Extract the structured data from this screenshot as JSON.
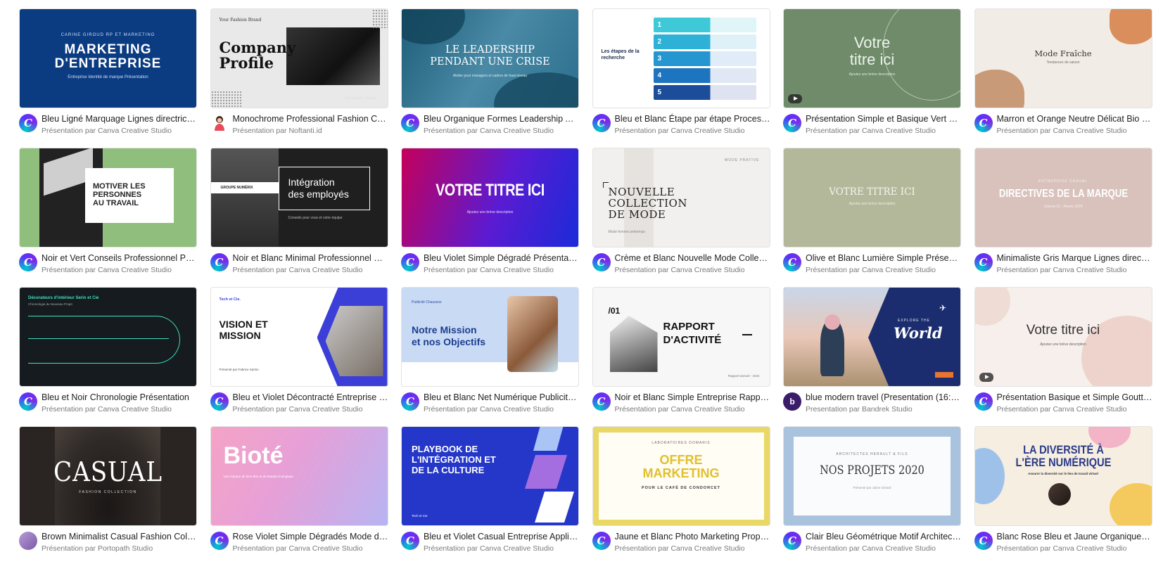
{
  "cards": [
    {
      "title": "Bleu Ligné Marquage Lignes directrices ...",
      "author": "Présentation par Canva Creative Studio",
      "avatar": "canva",
      "thumb": {
        "kicker": "CARINE GIROUD RP ET MARKETING",
        "heading": "MARKETING\nD'ENTREPRISE",
        "sub": "Entreprise Identité de marque Présentation"
      }
    },
    {
      "title": "Monochrome Professional Fashion Com...",
      "author": "Présentation par Noftanti.id",
      "avatar": "nofanti",
      "thumb": {
        "kicker": "Your Fashion Brand",
        "heading": "Company\nProfile",
        "sub": "Your Brand's Tagline"
      }
    },
    {
      "title": "Bleu Organique Formes Leadership Ateli...",
      "author": "Présentation par Canva Creative Studio",
      "avatar": "canva",
      "thumb": {
        "heading": "LE LEADERSHIP\nPENDANT UNE CRISE",
        "sub": "Atelier pour managers et cadres de haut niveau"
      }
    },
    {
      "title": "Bleu et Blanc Étape par étape Processus...",
      "author": "Présentation par Canva Creative Studio",
      "avatar": "canva",
      "thumb": {
        "heading": "Les étapes de la\nrecherche",
        "steps": [
          "1",
          "2",
          "3",
          "4",
          "5"
        ]
      }
    },
    {
      "title": "Présentation Simple et Basique Vert Go...",
      "author": "Présentation par Canva Creative Studio",
      "avatar": "canva",
      "thumb": {
        "heading": "Votre\ntitre ici",
        "sub": "Ajoutez une brève description"
      }
    },
    {
      "title": "Marron et Orange Neutre Délicat Bio Mo...",
      "author": "Présentation par Canva Creative Studio",
      "avatar": "canva",
      "thumb": {
        "heading": "Mode Fraîche",
        "sub": "Tendances de saison"
      }
    },
    {
      "title": "Noir et Vert Conseils Professionnel Prés...",
      "author": "Présentation par Canva Creative Studio",
      "avatar": "canva",
      "thumb": {
        "heading": "MOTIVER LES\nPERSONNES\nAU TRAVAIL"
      }
    },
    {
      "title": "Noir et Blanc Minimal Professionnel Pré...",
      "author": "Présentation par Canva Creative Studio",
      "avatar": "canva",
      "thumb": {
        "kicker": "GROUPE NUMÉRIX",
        "heading": "Intégration\ndes employés",
        "sub": "Conseils pour vous et votre équipe"
      }
    },
    {
      "title": "Bleu Violet Simple Dégradé Présentation",
      "author": "Présentation par Canva Creative Studio",
      "avatar": "canva",
      "thumb": {
        "heading": "VOTRE TITRE ICI",
        "sub": "Ajoutez une brève description"
      }
    },
    {
      "title": "Crème et Blanc Nouvelle Mode Collecti...",
      "author": "Présentation par Canva Creative Studio",
      "avatar": "canva",
      "thumb": {
        "kicker": "MODE PRATIVE",
        "heading": "NOUVELLE\nCOLLECTION\nDE MODE",
        "sub": "Mode femme printemps"
      }
    },
    {
      "title": "Olive et Blanc Lumière Simple Présentat...",
      "author": "Présentation par Canva Creative Studio",
      "avatar": "canva",
      "thumb": {
        "heading": "VOTRE TITRE ICI",
        "sub": "Ajoutez une brève description"
      }
    },
    {
      "title": "Minimaliste Gris Marque Lignes directric...",
      "author": "Présentation par Canva Creative Studio",
      "avatar": "canva",
      "thumb": {
        "kicker": "ENTREPRISE CASUAL",
        "heading": "DIRECTIVES DE LA MARQUE",
        "sub": "Volume 01 - Année 2024"
      }
    },
    {
      "title": "Bleu et Noir Chronologie Présentation",
      "author": "Présentation par Canva Creative Studio",
      "avatar": "canva",
      "thumb": {
        "heading": "Décorateurs d'intérieur Serin et Cie",
        "sub": "Chronologie du Nouveau Projet"
      }
    },
    {
      "title": "Bleu et Violet Décontracté Entreprise Vi...",
      "author": "Présentation par Canva Creative Studio",
      "avatar": "canva",
      "thumb": {
        "kicker": "Tech et Cie.",
        "heading": "VISION ET\nMISSION",
        "sub": "Présenté par Fabrice Sarlon"
      }
    },
    {
      "title": "Bleu et Blanc Net Numérique Publicité P...",
      "author": "Présentation par Canva Creative Studio",
      "avatar": "canva",
      "thumb": {
        "kicker": "Publicité Chaussos",
        "heading": "Notre Mission\net nos Objectifs"
      }
    },
    {
      "title": "Noir et Blanc Simple Entreprise Rapport...",
      "author": "Présentation par Canva Creative Studio",
      "avatar": "canva",
      "thumb": {
        "kicker": "/01",
        "heading": "RAPPORT\nD'ACTIVITÉ",
        "sub": "Rapport annuel - 2024"
      }
    },
    {
      "title": "blue modern travel (Presentation (16:9))",
      "author": "Presentation par Bandrek Studio",
      "avatar": "bandrek",
      "thumb": {
        "kicker": "EXPLORE THE",
        "heading": "World"
      }
    },
    {
      "title": "Présentation Basique et Simple Gouttes ...",
      "author": "Présentation par Canva Creative Studio",
      "avatar": "canva",
      "thumb": {
        "heading": "Votre titre ici",
        "sub": "Ajoutez une brève description"
      }
    },
    {
      "title": "Brown Minimalist Casual Fashion Collec...",
      "author": "Présentation par Portopath Studio",
      "avatar": "portopath",
      "thumb": {
        "heading": "CASUAL",
        "sub": "FASHION COLLECTION"
      }
    },
    {
      "title": "Rose Violet Simple Dégradés Mode de vi...",
      "author": "Présentation par Canva Creative Studio",
      "avatar": "canva",
      "thumb": {
        "heading": "Bioté",
        "sub": "Une marque de bien-être et de beauté écologique"
      }
    },
    {
      "title": "Bleu et Violet Casual Entreprise Applica...",
      "author": "Présentation par Canva Creative Studio",
      "avatar": "canva",
      "thumb": {
        "heading": "PLAYBOOK DE\nL'INTÉGRATION ET\nDE LA CULTURE",
        "sub": "Tech et Cie"
      }
    },
    {
      "title": "Jaune et Blanc Photo Marketing Proposi...",
      "author": "Présentation par Canva Creative Studio",
      "avatar": "canva",
      "thumb": {
        "kicker": "LABORATOIRES DOMARIS",
        "heading": "OFFRE\nMARKETING",
        "sub": "POUR LE CAFÉ DE CONDORCET"
      }
    },
    {
      "title": "Clair Bleu Géométrique Motif Architect...",
      "author": "Présentation par Canva Creative Studio",
      "avatar": "canva",
      "thumb": {
        "kicker": "ARCHITECTES HERAULT & FILS",
        "heading": "NOS PROJETS 2020",
        "sub": "Présenté par Julien Gérard"
      }
    },
    {
      "title": "Blanc Rose Bleu et Jaune Organique For...",
      "author": "Présentation par Canva Creative Studio",
      "avatar": "canva",
      "thumb": {
        "heading": "LA DIVERSITÉ À\nL'ÈRE NUMÉRIQUE",
        "sub": "Assurer la diversité sur le lieu de travail virtuel"
      }
    }
  ],
  "icons": {
    "canva": "C",
    "bandrek": "b"
  }
}
